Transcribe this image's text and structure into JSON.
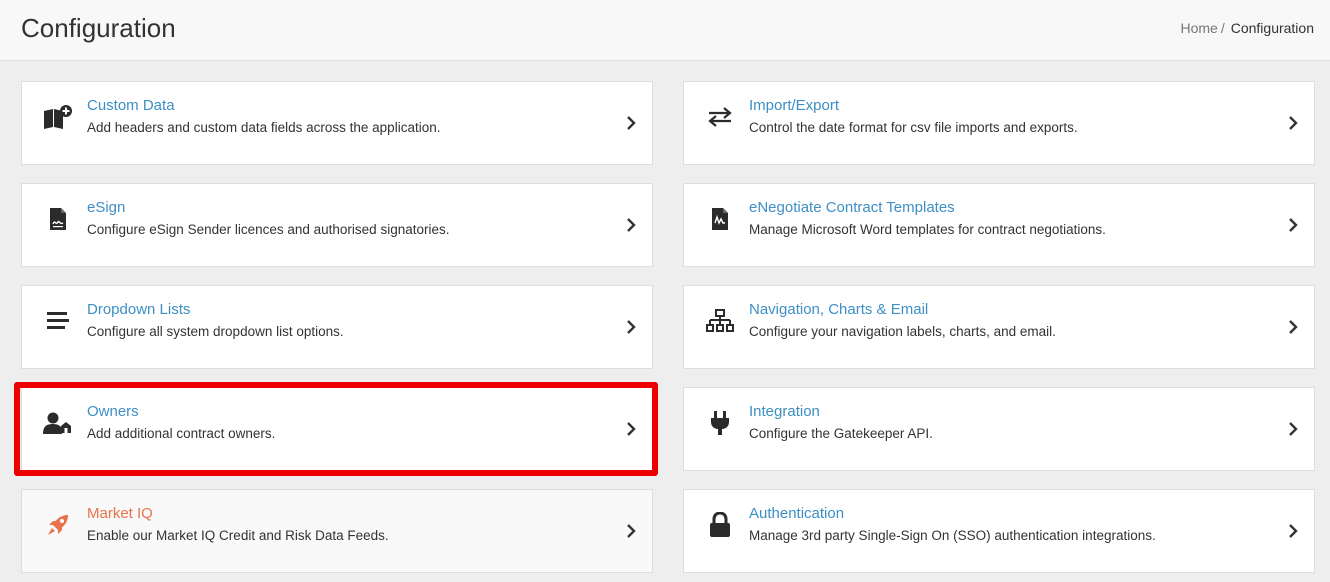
{
  "header": {
    "title": "Configuration",
    "breadcrumb": {
      "home": "Home",
      "separator": "/",
      "current": "Configuration"
    }
  },
  "colors": {
    "link": "#3d8fc5",
    "accent_orange": "#e8734a",
    "highlight": "#ee0000"
  },
  "cards": [
    {
      "title": "Custom Data",
      "description": "Add headers and custom data fields across the application.",
      "icon": "book-plus-icon"
    },
    {
      "title": "Import/Export",
      "description": "Control the date format for csv file imports and exports.",
      "icon": "arrows-exchange-icon"
    },
    {
      "title": "eSign",
      "description": "Configure eSign Sender licences and authorised signatories.",
      "icon": "signed-document-icon"
    },
    {
      "title": "eNegotiate Contract Templates",
      "description": "Manage Microsoft Word templates for contract negotiations.",
      "icon": "contract-file-icon"
    },
    {
      "title": "Dropdown Lists",
      "description": "Configure all system dropdown list options.",
      "icon": "list-lines-icon"
    },
    {
      "title": "Navigation, Charts & Email",
      "description": "Configure your navigation labels, charts, and email.",
      "icon": "sitemap-icon"
    },
    {
      "title": "Owners",
      "description": "Add additional contract owners.",
      "icon": "user-gear-icon"
    },
    {
      "title": "Integration",
      "description": "Configure the Gatekeeper API.",
      "icon": "plug-icon"
    },
    {
      "title": "Market IQ",
      "description": "Enable our Market IQ Credit and Risk Data Feeds.",
      "icon": "rocket-icon"
    },
    {
      "title": "Authentication",
      "description": "Manage 3rd party Single-Sign On (SSO) authentication integrations.",
      "icon": "lock-icon"
    }
  ]
}
